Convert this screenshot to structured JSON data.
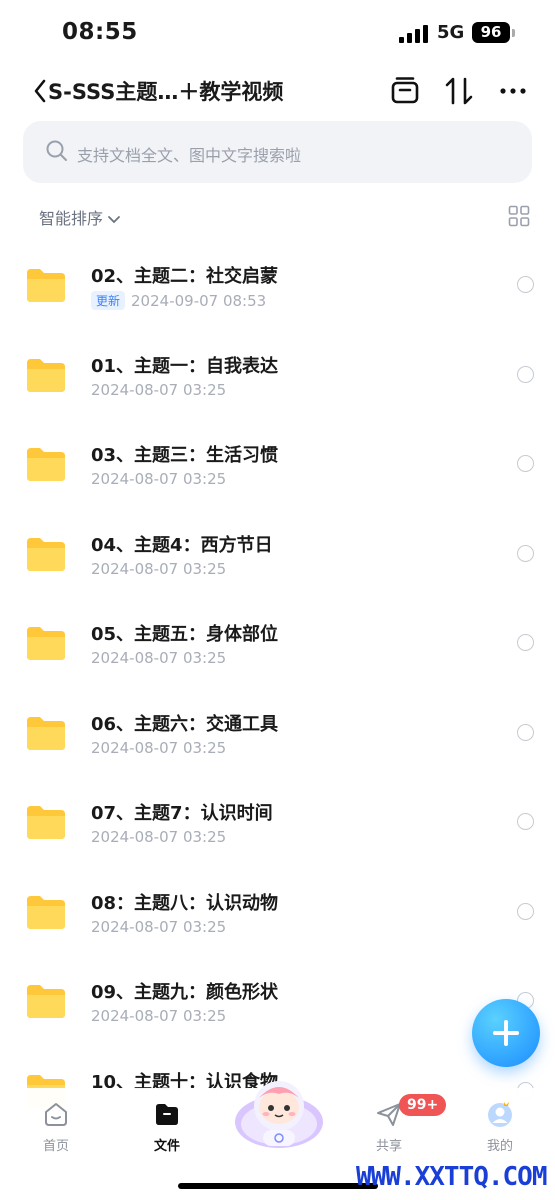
{
  "status_bar": {
    "time": "08:55",
    "network": "5G",
    "battery": "96"
  },
  "nav": {
    "title": "S-SSS主题…＋教学视频",
    "icons": [
      "back-chevron-icon",
      "stack-icon",
      "sort-arrows-icon",
      "more-icon"
    ]
  },
  "search": {
    "placeholder": "支持文档全文、图中文字搜索啦"
  },
  "sort": {
    "label": "智能排序"
  },
  "folders": [
    {
      "name": "02、主题二：社交启蒙",
      "tag": "更新",
      "date": "2024-09-07 08:53"
    },
    {
      "name": "01、主题一：自我表达",
      "date": "2024-08-07 03:25"
    },
    {
      "name": "03、主题三：生活习惯",
      "date": "2024-08-07 03:25"
    },
    {
      "name": "04、主题4：西方节日",
      "date": "2024-08-07 03:25"
    },
    {
      "name": "05、主题五：身体部位",
      "date": "2024-08-07 03:25"
    },
    {
      "name": "06、主题六：交通工具",
      "date": "2024-08-07 03:25"
    },
    {
      "name": "07、主题7：认识时间",
      "date": "2024-08-07 03:25"
    },
    {
      "name": "08：主题八：认识动物",
      "date": "2024-08-07 03:25"
    },
    {
      "name": "09、主题九：颜色形状",
      "date": "2024-08-07 03:25"
    },
    {
      "name": "10、主题十：认识食物",
      "date": ""
    }
  ],
  "tabbar": {
    "home": "首页",
    "files": "文件",
    "share": "共享",
    "share_badge": "99+",
    "mine": "我的"
  },
  "colors": {
    "accent": "#1a8cff",
    "folder": "#ffc83a",
    "badge": "#f05454",
    "watermark": "#1a3fd6"
  },
  "watermark": "WWW.XXTTQ.COM"
}
